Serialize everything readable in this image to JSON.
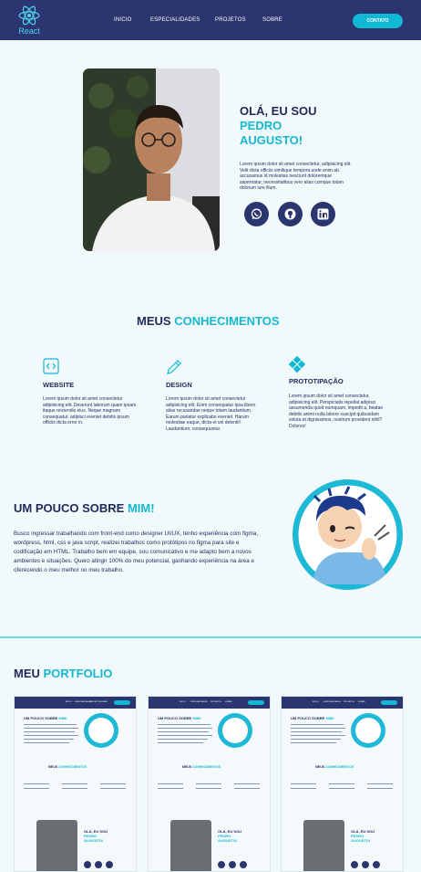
{
  "header": {
    "logo_text": "React",
    "nav": [
      "INICIO",
      "ESPECIALIDADES",
      "PROJETOS",
      "SOBRE"
    ],
    "contact_label": "CONTATO",
    "colors": {
      "bar": "#2b3670",
      "accent": "#11b8d3"
    }
  },
  "hero": {
    "greeting": "OLÁ, EU SOU",
    "name_line1": "PEDRO",
    "name_line2": "AUGUSTO!",
    "description": "Lorem ipsum dolor sit amet consectetur, adipisicing elit. Velit dicta officiis similique tempora unde enim ab accusamus id molestias nesciunt doloremque aspernatur, necessitatibus vero alias cumque totam dolorum iure illum.",
    "socials": [
      "whatsapp-icon",
      "github-icon",
      "linkedin-icon"
    ]
  },
  "skills": {
    "title_plain": "MEUS",
    "title_accent": "CONHECIMENTOS",
    "items": [
      {
        "icon": "code-icon",
        "title": "WEBSITE",
        "desc": "Lorem ipsum dolor sit amet consectetur adipisicing elit. Deserunt laborum quam ipsam itaque reiciendis eius. Neque magnam consequatur, adipisci eveniet debitis ipsum officiis dicta error in."
      },
      {
        "icon": "pencil-icon",
        "title": "DESIGN",
        "desc": "Lorem ipsum dolor sit amet consectetur adipisicing elit. Enim consequatur ipsa libero alias recusandae neque totam laudantium. Earum pariatur explicabo eveniet. Harum molestiae eaque, dicta et vel deleniti! Laudantium, consequuntur."
      },
      {
        "icon": "diamond-icon",
        "title": "PROTOTIPAÇÃO",
        "desc": "Lorem ipsum dolor sit amet consectetur, adipisicing elit. Perspiciatis repellat adipisci assumenda quod numquam, impedit a, beatae debitis animi nulla labore suscipit quibusdam soluta et dignissimos, nostrum provident nihil? Dolores!"
      }
    ]
  },
  "about": {
    "title_plain": "UM POUCO SOBRE",
    "title_accent": "MIM!",
    "text": "Busco ingressar trabalhando com front-end como designer UI/UX, tenho experiência com figma, wordpress, html, css e java script, realizei trabalhos como protótipos no figma para site e codificação em HTML. Trabalho bem em equipe, sou comunicativo e me adapto bem a novos ambientes e situações. Quero atingir 100% do meu potencial, ganhando experiência na área e oferecendo o meu melhor no meu trabalho."
  },
  "portfolio": {
    "title_plain": "MEU",
    "title_accent": "PORTFOLIO",
    "thumbs": [
      {
        "nav": [
          "INICIO",
          "ESPECIALIDADES",
          "PROJETOS",
          "SOBRE"
        ],
        "about": "UM POUCO SOBRE",
        "about_accent": "MIM!",
        "skills": "MEUS",
        "skills_accent": "CONHECIMENTOS",
        "hello": "OLÁ, EU SOU",
        "name1": "PEDRO",
        "name2": "AUGUSTO!"
      },
      {
        "nav": [
          "INICIO",
          "ESPECIALIDADES",
          "PROJETOS",
          "SOBRE"
        ],
        "about": "UM POUCO SOBRE",
        "about_accent": "MIM!",
        "skills": "MEUS",
        "skills_accent": "CONHECIMENTOS",
        "hello": "OLÁ, EU SOU",
        "name1": "PEDRO",
        "name2": "AUGUSTO!"
      },
      {
        "nav": [
          "INICIO",
          "ESPECIALIDADES",
          "PROJETOS",
          "SOBRE"
        ],
        "about": "UM POUCO SOBRE",
        "about_accent": "MIM!",
        "skills": "MEUS",
        "skills_accent": "CONHECIMENTOS",
        "hello": "OLÁ, EU SOU",
        "name1": "PEDRO",
        "name2": "AUGUSTO!"
      }
    ]
  }
}
